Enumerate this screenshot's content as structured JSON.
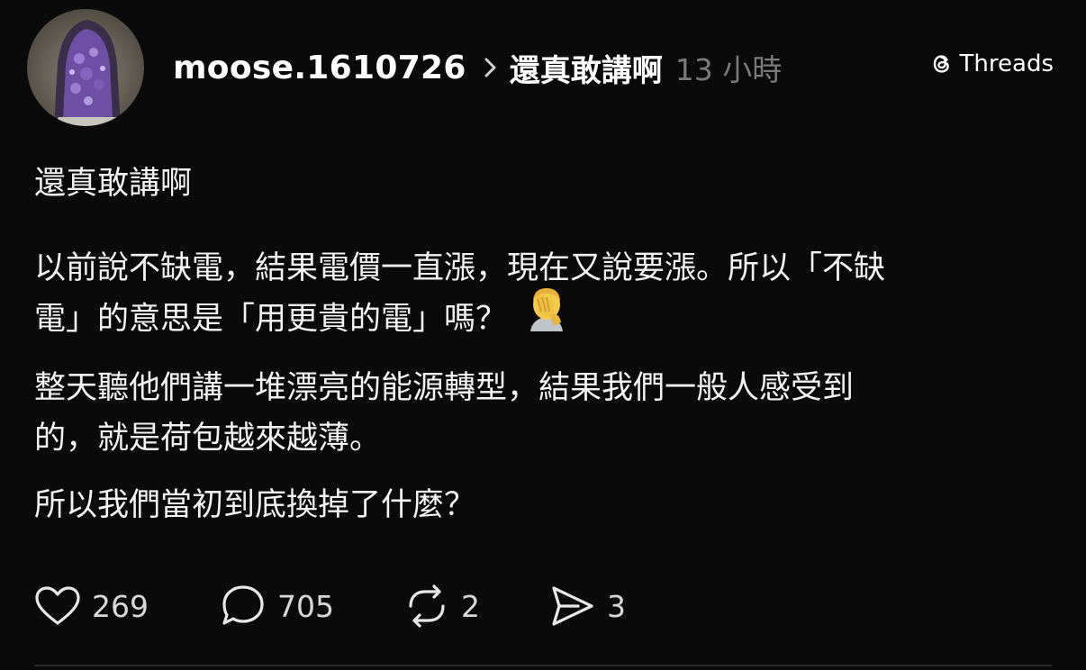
{
  "post": {
    "username": "moose.1610726",
    "topic": "還真敢講啊",
    "time": "13 小時",
    "brand": "Threads",
    "title": "還真敢講啊",
    "p2_line1": "以前說不缺電，結果電價一直漲，現在又說要漲。所以「不缺",
    "p2_line2": "電」的意思是「用更貴的電」嗎？",
    "p3_line1": "整天聽他們講一堆漂亮的能源轉型，結果我們一般人感受到",
    "p3_line2": "的，就是荷包越來越薄。",
    "p4": "所以我們當初到底換掉了什麼？"
  },
  "actions": {
    "likes": "269",
    "comments": "705",
    "reposts": "2",
    "shares": "3"
  },
  "icons": {
    "avatar": "amethyst-geode-photo",
    "chevron": "chevron-right-icon",
    "brand": "threads-logo-icon",
    "emoji": "face-palm-emoji",
    "like": "heart-icon",
    "comment": "comment-bubble-icon",
    "repost": "repost-icon",
    "share": "send-icon"
  },
  "colors": {
    "background": "#0a0a0a",
    "text": "#f2f2f2",
    "muted": "#7a7a7a"
  }
}
